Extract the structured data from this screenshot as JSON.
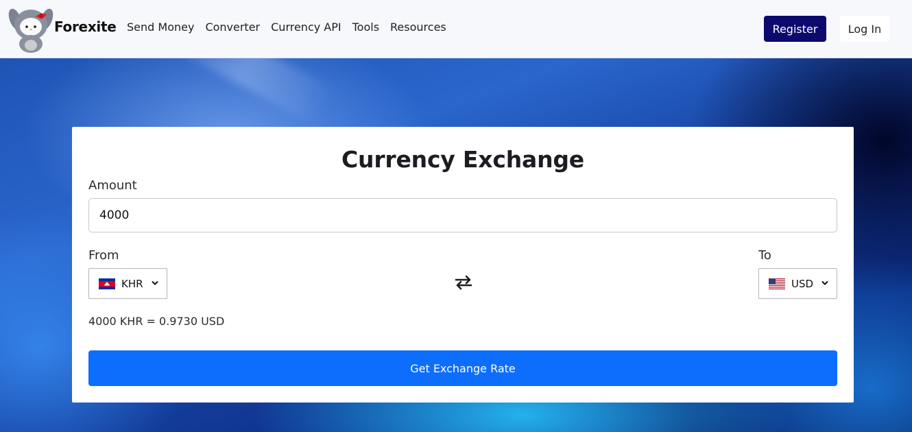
{
  "brand": {
    "name": "Forexite",
    "logo_icon": "hello-kitty-plush-logo"
  },
  "nav": {
    "links": [
      "Send Money",
      "Converter",
      "Currency API",
      "Tools",
      "Resources"
    ],
    "register_label": "Register",
    "login_label": "Log In"
  },
  "colors": {
    "register_bg": "#0d0a6e",
    "primary_button": "#0d6efd",
    "navbar_bg": "#f7f8fb"
  },
  "form": {
    "title": "Currency Exchange",
    "amount_label": "Amount",
    "amount_value": "4000",
    "from_label": "From",
    "to_label": "To",
    "from_currency": "KHR",
    "to_currency": "USD",
    "from_flag_icon": "cambodia-flag-icon",
    "to_flag_icon": "usa-flag-icon",
    "swap_icon": "swap-arrows-icon",
    "result": "4000 KHR = 0.9730 USD",
    "submit_label": "Get Exchange Rate"
  }
}
